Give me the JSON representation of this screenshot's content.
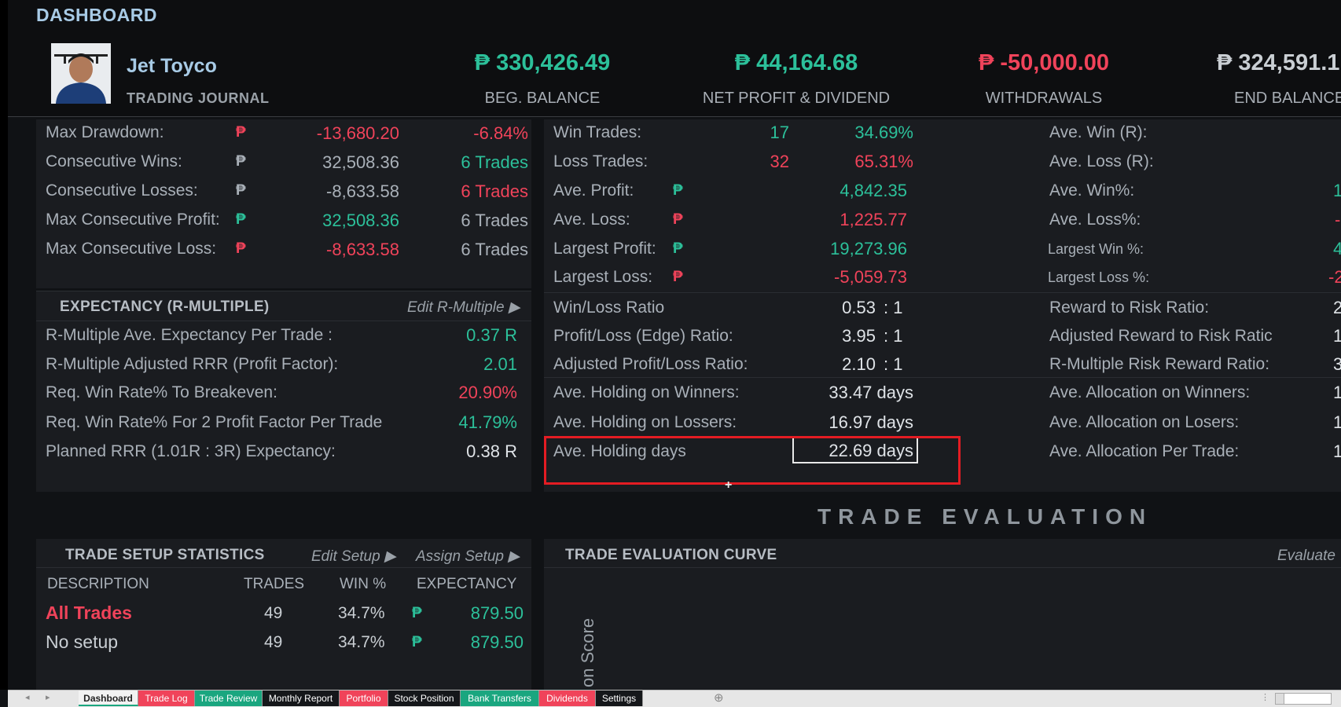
{
  "header": {
    "title": "DASHBOARD",
    "name": "Jet Toyco",
    "subtitle": "TRADING JOURNAL",
    "summary": [
      {
        "value": "₱ 330,426.49",
        "label": "BEG. BALANCE",
        "color": "#2cc09a"
      },
      {
        "value": "₱ 44,164.68",
        "label": "NET PROFIT & DIVIDEND",
        "color": "#2cc09a"
      },
      {
        "value": "₱ -50,000.00",
        "label": "WITHDRAWALS",
        "color": "#f0435a"
      },
      {
        "value": "₱ 324,591.1",
        "label": "END BALANCE",
        "color": "#c9ced3"
      }
    ]
  },
  "drawdown": {
    "rows": [
      {
        "label": "Max Drawdown:",
        "peso": "₱",
        "value": "-13,680.20",
        "extra": "-6.84%"
      },
      {
        "label": "Consecutive Wins:",
        "peso": "₱",
        "value": "32,508.36",
        "extra": "6 Trades"
      },
      {
        "label": "Consecutive Losses:",
        "peso": "₱",
        "value": "-8,633.58",
        "extra": "6 Trades"
      },
      {
        "label": "Max Consecutive Profit:",
        "peso": "₱",
        "value": "32,508.36",
        "extra": "6 Trades"
      },
      {
        "label": "Max Consecutive Loss:",
        "peso": "₱",
        "value": "-8,633.58",
        "extra": "6 Trades"
      }
    ]
  },
  "expectancy": {
    "title": "EXPECTANCY (R-MULTIPLE)",
    "edit_label": "Edit R-Multiple ▶",
    "rows": [
      {
        "label": "R-Multiple Ave. Expectancy Per Trade :",
        "value": "0.37 R"
      },
      {
        "label": "R-Multiple Adjusted RRR (Profit Factor):",
        "value": "2.01"
      },
      {
        "label": "Req. Win Rate% To Breakeven:",
        "value": "20.90%"
      },
      {
        "label": "Req. Win Rate% For 2 Profit Factor Per Trade",
        "value": "41.79%"
      },
      {
        "label": "Planned RRR (1.01R : 3R) Expectancy:",
        "value": "0.38 R"
      }
    ]
  },
  "stats": {
    "trades": [
      {
        "label": "Win Trades:",
        "count": "17",
        "pct": "34.69%"
      },
      {
        "label": "Loss Trades:",
        "count": "32",
        "pct": "65.31%"
      }
    ],
    "money": [
      {
        "label": "Ave. Profit:",
        "peso": "₱",
        "value": "4,842.35"
      },
      {
        "label": "Ave. Loss:",
        "peso": "₱",
        "value": "1,225.77"
      },
      {
        "label": "Largest Profit:",
        "peso": "₱",
        "value": "19,273.96"
      },
      {
        "label": "Largest Loss:",
        "peso": "₱",
        "value": "-5,059.73"
      }
    ],
    "ratios": [
      {
        "label": "Win/Loss Ratio",
        "value": "0.53",
        "suffix": ": 1"
      },
      {
        "label": "Profit/Loss (Edge) Ratio:",
        "value": "3.95",
        "suffix": ": 1"
      },
      {
        "label": "Adjusted Profit/Loss Ratio:",
        "value": "2.10",
        "suffix": ": 1"
      }
    ],
    "holding": [
      {
        "label": "Ave. Holding on Winners:",
        "value": "33.47 days"
      },
      {
        "label": "Ave. Holding on Lossers:",
        "value": "16.97 days"
      },
      {
        "label": "Ave. Holding days",
        "value": "22.69 days"
      }
    ]
  },
  "right_col": {
    "rows": [
      {
        "label": "Ave. Win (R):",
        "value": ""
      },
      {
        "label": "Ave. Loss (R):",
        "value": ""
      },
      {
        "label": "Ave. Win%:",
        "value": "1"
      },
      {
        "label": "Ave. Loss%:",
        "value": "-"
      },
      {
        "label": "Largest Win %:",
        "value": "4"
      },
      {
        "label": "Largest Loss %:",
        "value": "-2"
      },
      {
        "label": "Reward to Risk Ratio:",
        "value": "2"
      },
      {
        "label": "Adjusted Reward to Risk Ratic",
        "value": "1"
      },
      {
        "label": "R-Multiple Risk Reward Ratio:",
        "value": "3"
      },
      {
        "label": "Ave. Allocation on Winners:",
        "value": "1"
      },
      {
        "label": "Ave. Allocation on Losers:",
        "value": "1"
      },
      {
        "label": "Ave. Allocation Per Trade:",
        "value": "1"
      }
    ]
  },
  "trade_eval": {
    "heading": "TRADE  EVALUATION",
    "curve_title": "TRADE EVALUATION CURVE",
    "evaluate_label": "Evaluate",
    "axis_label": "on Score"
  },
  "setup": {
    "title": "TRADE SETUP STATISTICS",
    "edit_label": "Edit Setup ▶",
    "assign_label": "Assign Setup ▶",
    "columns": [
      "DESCRIPTION",
      "TRADES",
      "WIN %",
      "EXPECTANCY"
    ],
    "rows": [
      {
        "desc": "All Trades",
        "trades": "49",
        "win": "34.7%",
        "peso": "₱",
        "exp": "879.50"
      },
      {
        "desc": "No setup",
        "trades": "49",
        "win": "34.7%",
        "peso": "₱",
        "exp": "879.50"
      }
    ]
  },
  "tabs": [
    {
      "label": "Dashboard",
      "color": "#f2f2f2",
      "text": "#222"
    },
    {
      "label": "Trade Log",
      "color": "#f0435a",
      "text": "#fff"
    },
    {
      "label": "Trade Review",
      "color": "#1aa67f",
      "text": "#fff"
    },
    {
      "label": "Monthly Report",
      "color": "#15171a",
      "text": "#fff"
    },
    {
      "label": "Portfolio",
      "color": "#f0435a",
      "text": "#fff"
    },
    {
      "label": "Stock Position",
      "color": "#15171a",
      "text": "#fff"
    },
    {
      "label": "Bank Transfers",
      "color": "#1aa67f",
      "text": "#fff"
    },
    {
      "label": "Dividends",
      "color": "#f0435a",
      "text": "#fff"
    },
    {
      "label": "Settings",
      "color": "#15171a",
      "text": "#fff"
    }
  ]
}
